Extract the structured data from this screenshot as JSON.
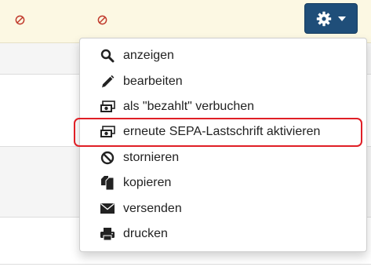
{
  "menu": {
    "items": [
      {
        "label": "anzeigen",
        "icon": "search-icon"
      },
      {
        "label": "bearbeiten",
        "icon": "pencil-icon"
      },
      {
        "label": "als \"bezahlt\" verbuchen",
        "icon": "money-icon"
      },
      {
        "label": "erneute SEPA-Lastschrift aktivieren",
        "icon": "money-icon"
      },
      {
        "label": "stornieren",
        "icon": "ban-icon"
      },
      {
        "label": "kopieren",
        "icon": "copy-icon"
      },
      {
        "label": "versenden",
        "icon": "envelope-icon"
      },
      {
        "label": "drucken",
        "icon": "print-icon"
      }
    ]
  },
  "colors": {
    "accent": "#1f4e79",
    "header_row": "#fcf8e3",
    "ban": "#c0392b",
    "highlight": "#e01f26"
  }
}
